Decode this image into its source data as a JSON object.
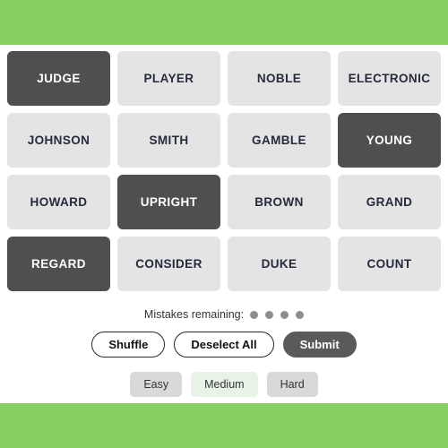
{
  "theme": {
    "banner_color": "#85cf63",
    "tile_unselected_bg": "#e4e4e4",
    "tile_unselected_text": "#262b3c",
    "tile_selected_bg": "#4f4f4f",
    "tile_selected_text": "#ffffff",
    "dot_color": "#8e8e8e",
    "submit_bg": "#5a5a5a",
    "difficulty_bg": "#d9d9d9",
    "difficulty_active_bg": "#e8f3e8"
  },
  "board": {
    "columns": 4,
    "rows": 4,
    "tiles": [
      {
        "label": "JUDGE",
        "selected": true
      },
      {
        "label": "PLAYER",
        "selected": false
      },
      {
        "label": "NOBLE",
        "selected": false
      },
      {
        "label": "ELECTRONIC",
        "selected": false
      },
      {
        "label": "JOHNSON",
        "selected": false
      },
      {
        "label": "SMITH",
        "selected": false
      },
      {
        "label": "GAMBLE",
        "selected": false
      },
      {
        "label": "YOUNG",
        "selected": true
      },
      {
        "label": "HOWARD",
        "selected": false
      },
      {
        "label": "UPRIGHT",
        "selected": true
      },
      {
        "label": "BROWN",
        "selected": false
      },
      {
        "label": "GRAND",
        "selected": false
      },
      {
        "label": "REGARD",
        "selected": true
      },
      {
        "label": "CONSIDER",
        "selected": false
      },
      {
        "label": "DUKE",
        "selected": false
      },
      {
        "label": "COUNT",
        "selected": false
      }
    ]
  },
  "mistakes": {
    "label": "Mistakes remaining:",
    "remaining": 4
  },
  "actions": {
    "shuffle_label": "Shuffle",
    "deselect_label": "Deselect All",
    "submit_label": "Submit"
  },
  "difficulty": {
    "selected": "Medium",
    "options": [
      {
        "label": "Easy",
        "active": false
      },
      {
        "label": "Medium",
        "active": true
      },
      {
        "label": "Hard",
        "active": false
      }
    ]
  }
}
